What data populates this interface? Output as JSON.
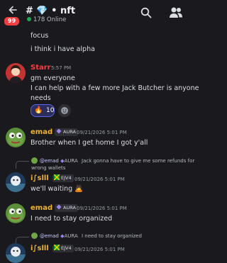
{
  "header": {
    "back_label": "←",
    "badge": "99",
    "channel_name": "# 💎 • nft",
    "online": "178 Online"
  },
  "messages": [
    {
      "text": "focus"
    },
    {
      "text": "i think i have alpha"
    },
    {
      "author": "Starr",
      "time": "5:57 PM",
      "lines": [
        "gm everyone",
        "I can help with a few more Jack Butcher is anyone",
        "needs"
      ],
      "reaction": {
        "emoji": "🔥",
        "count": "10"
      }
    },
    {
      "author": "emad",
      "tag": "AURA",
      "time": "09/21/2026 5:01 PM",
      "text": "Brother when I get home I got y'all"
    },
    {
      "reply": {
        "mention": "@emad",
        "tag": "AURA",
        "text": "Jack gonna have to give me some refunds for",
        "text2": "wrong wallets"
      },
      "author": "i∫slll",
      "tag": "EJV4",
      "time": "09/21/2026 5:01 PM",
      "text": "we'll waiting 🙇"
    },
    {
      "author": "emad",
      "tag": "AURA",
      "time": "09/21/2026 5:01 PM",
      "text": "I need to stay organized"
    },
    {
      "reply": {
        "mention": "@emad",
        "tag": "AURA",
        "text": "I need to stay organized"
      },
      "author": "i∫slll",
      "tag": "EJV4",
      "time": "09/21/2026 5:01 PM"
    }
  ],
  "colors": {
    "starr": "#f23f43",
    "emad": "#f0b232",
    "islll": "#f0b232",
    "accent": "#5865f2",
    "online": "#23a55a"
  }
}
